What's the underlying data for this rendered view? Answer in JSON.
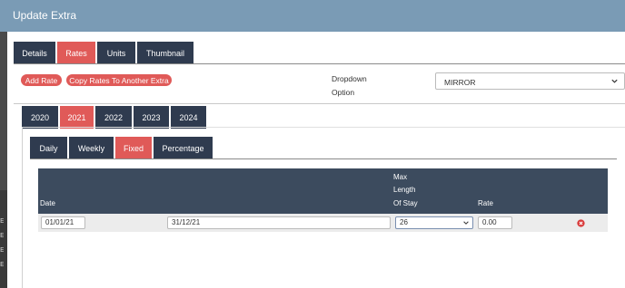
{
  "modal": {
    "title": "Update Extra"
  },
  "main_tabs": [
    {
      "label": "Details"
    },
    {
      "label": "Rates",
      "active": true
    },
    {
      "label": "Units"
    },
    {
      "label": "Thumbnail"
    }
  ],
  "actions": {
    "add_rate": "Add Rate",
    "copy_rates": "Copy Rates To Another Extra"
  },
  "dropdown_option": {
    "label_line1": "Dropdown",
    "label_line2": "Option",
    "value": "MIRROR"
  },
  "year_tabs": [
    {
      "label": "2020"
    },
    {
      "label": "2021",
      "active": true
    },
    {
      "label": "2022"
    },
    {
      "label": "2023"
    },
    {
      "label": "2024"
    }
  ],
  "rate_type_tabs": [
    {
      "label": "Daily"
    },
    {
      "label": "Weekly"
    },
    {
      "label": "Fixed",
      "active": true
    },
    {
      "label": "Percentage"
    }
  ],
  "table": {
    "headers": {
      "date": "Date",
      "max_line1": "Max",
      "max_line2": "Length",
      "max_line3": "Of Stay",
      "rate": "Rate"
    },
    "row": {
      "start_date": "01/01/21",
      "end_date": "31/12/21",
      "max_length_of_stay": "26",
      "rate": "0.00"
    }
  },
  "background_letters": [
    "E",
    "E",
    "E",
    "E"
  ],
  "colors": {
    "header": "#7a9bb5",
    "tab_dark": "#2f3b4f",
    "accent": "#e05a58",
    "table_header": "#3c4b5e"
  },
  "icons": {
    "select_chevron": "chevron-down-icon",
    "delete": "close-circle-icon"
  }
}
